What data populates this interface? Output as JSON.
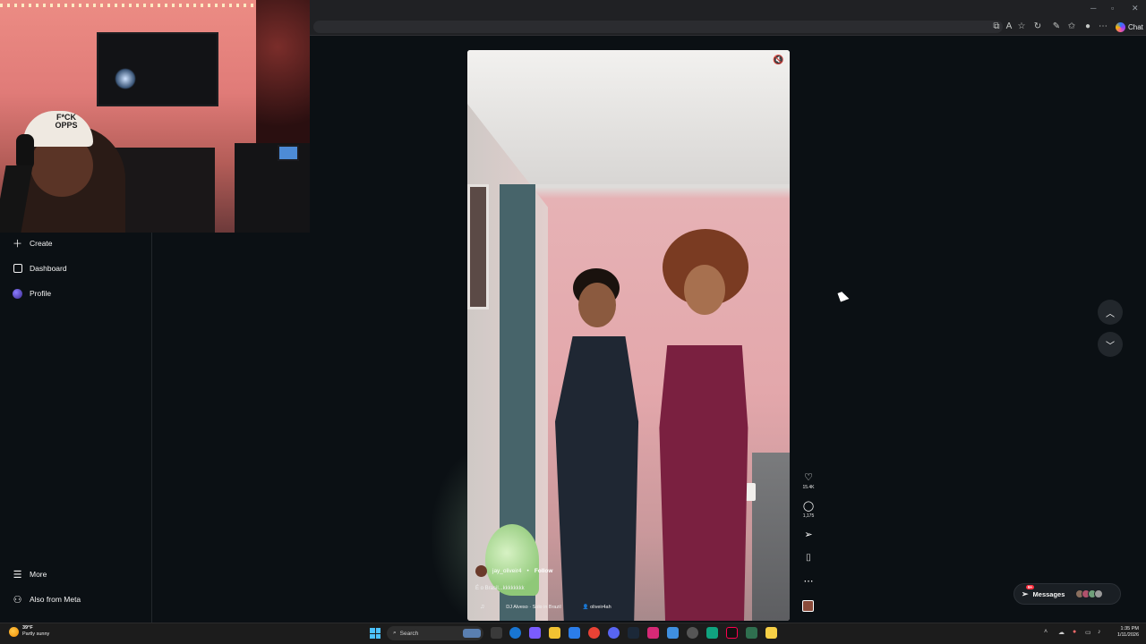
{
  "browser": {
    "copilot_label": "Chat"
  },
  "webcam": {
    "cap_text": "F*CK OPPS"
  },
  "sidebar": {
    "items": [
      {
        "label": "Create",
        "icon": "plus-icon"
      },
      {
        "label": "Dashboard",
        "icon": "dashboard-icon"
      },
      {
        "label": "Profile",
        "icon": "profile-avatar"
      },
      {
        "label": "More",
        "icon": "menu-icon"
      },
      {
        "label": "Also from Meta",
        "icon": "meta-icon"
      }
    ]
  },
  "reel": {
    "author": "jay_oliveir4",
    "separator": "•",
    "follow_label": "Follow",
    "caption": "É o Brasil...kkkkkkkk",
    "audio": "DJ Alveso · Solo in Brazil",
    "tagged_user": "oliveir4ah",
    "likes": "15.4K",
    "comments": "1,175"
  },
  "messages": {
    "label": "Messages",
    "badge": "9+"
  },
  "taskbar": {
    "weather_temp": "39°F",
    "weather_desc": "Partly sunny",
    "search_placeholder": "Search",
    "time": "1:35 PM",
    "date": "1/11/2026"
  },
  "colors": {
    "background": "#0b1014",
    "accent_blue": "#4cc2ff",
    "notification_red": "#ff3040"
  }
}
